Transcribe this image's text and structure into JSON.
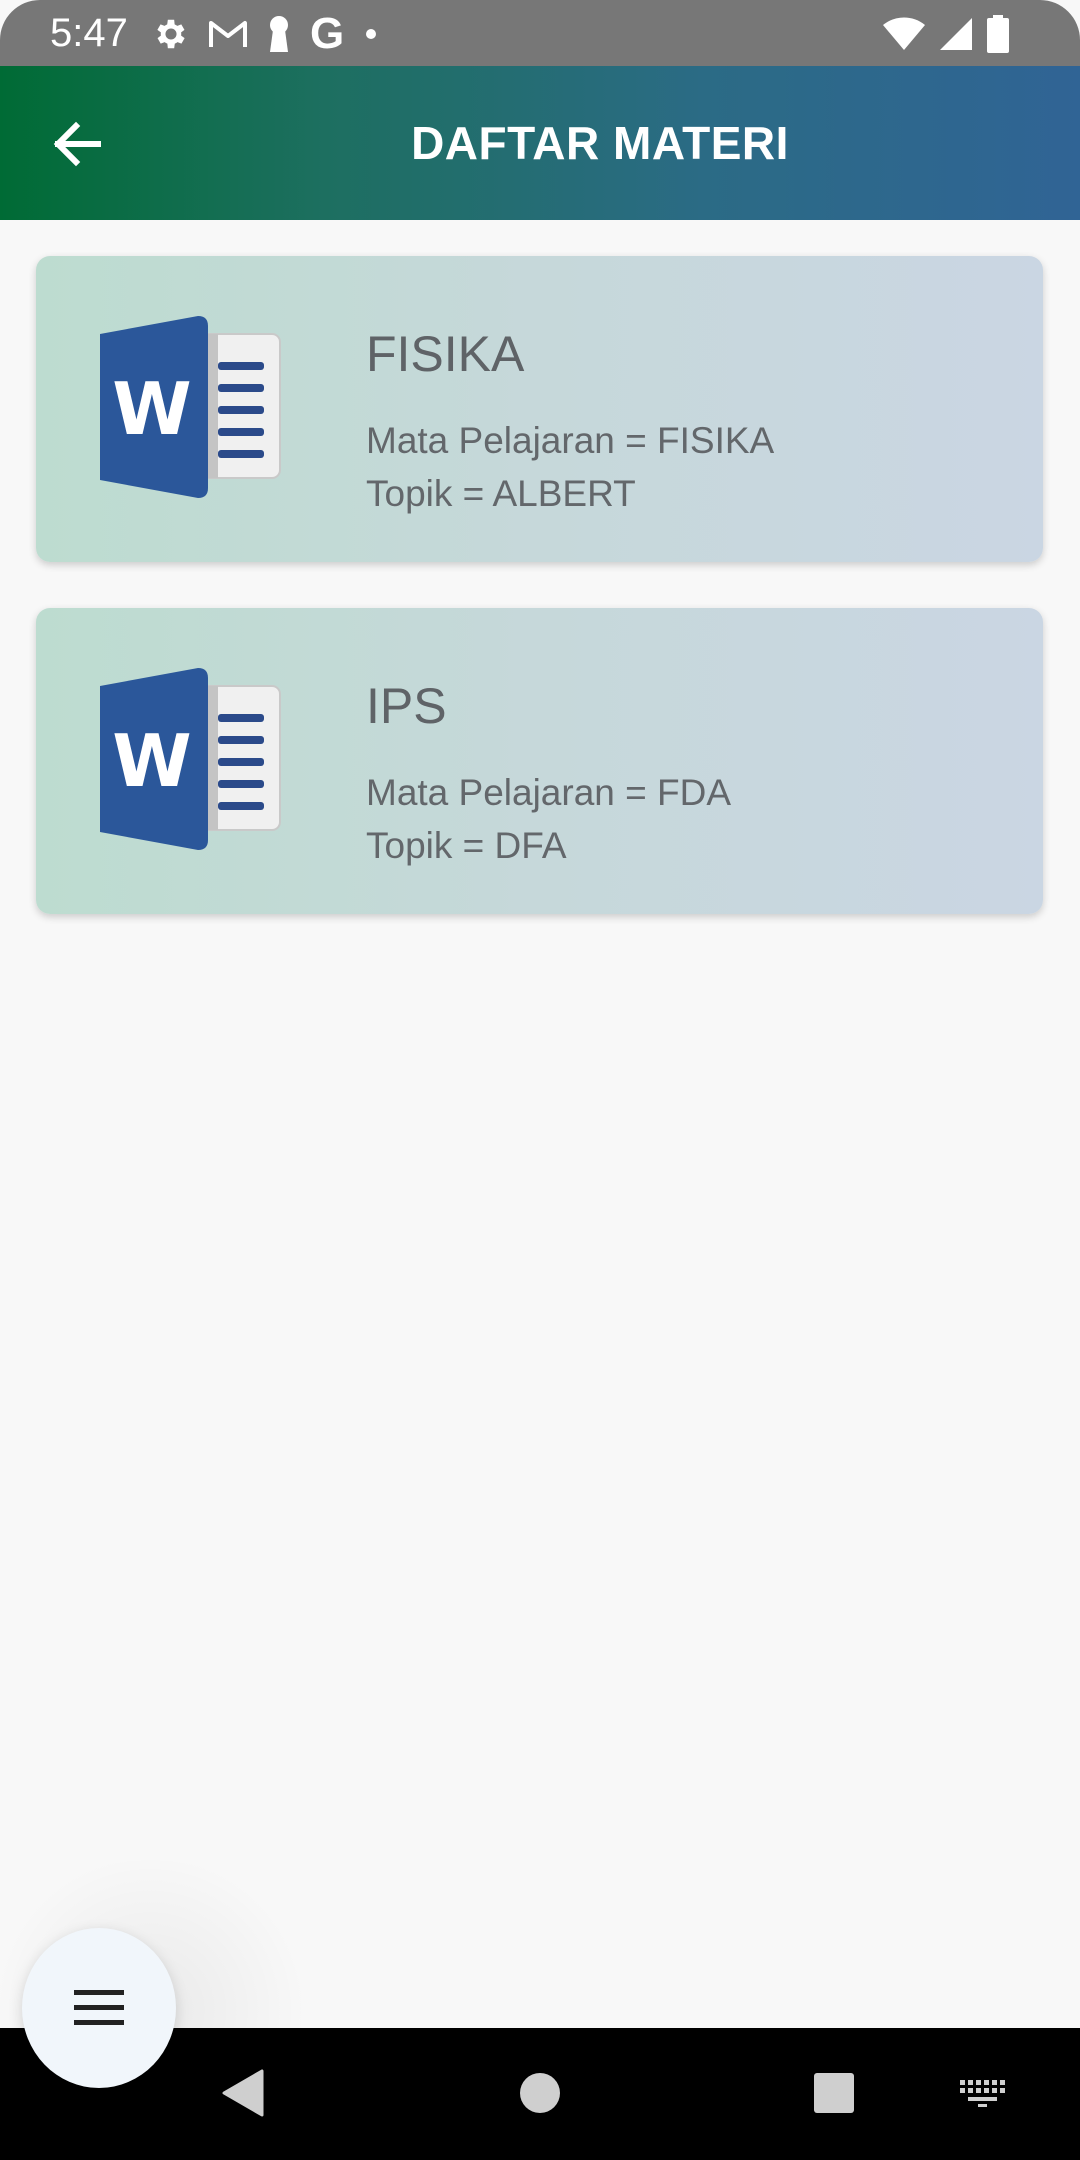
{
  "status_bar": {
    "time": "5:47",
    "left_icons": [
      "settings-icon",
      "gmail-icon",
      "keyhole-icon",
      "google-icon",
      "dot-icon"
    ],
    "google_letter": "G",
    "right_icons": [
      "wifi-icon",
      "cellular-icon",
      "battery-icon"
    ]
  },
  "app_bar": {
    "title": "DAFTAR MATERI",
    "back_icon": "arrow-left-icon",
    "gradient_start": "#006b35",
    "gradient_end": "#306495"
  },
  "materials": [
    {
      "icon": "word-document-icon",
      "title": "FISIKA",
      "subject_line": "Mata Pelajaran = FISIKA",
      "topic_line": "Topik = ALBERT"
    },
    {
      "icon": "word-document-icon",
      "title": "IPS",
      "subject_line": "Mata Pelajaran = FDA",
      "topic_line": "Topik = DFA"
    }
  ],
  "fab": {
    "icon": "menu-icon"
  },
  "nav_bar": {
    "buttons": [
      "back-triangle-icon",
      "home-circle-icon",
      "recents-square-icon",
      "keyboard-icon"
    ]
  },
  "colors": {
    "word_blue": "#2b579a",
    "card_text": "#5f6367",
    "background": "#f8f8f8"
  }
}
